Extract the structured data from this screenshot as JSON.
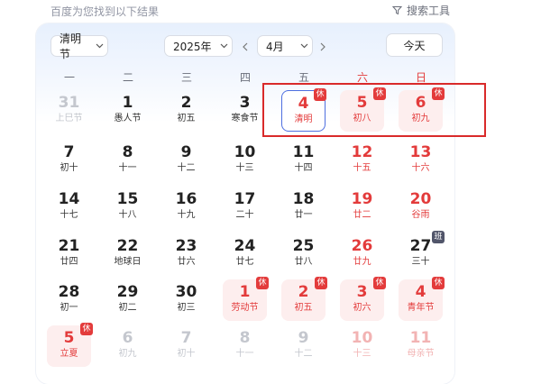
{
  "top": {
    "result_note": "百度为您找到以下结果",
    "tools_label": "搜索工具"
  },
  "controls": {
    "holiday": "清明节",
    "year": "2025年",
    "month": "4月",
    "today": "今天"
  },
  "weekdays": [
    "一",
    "二",
    "三",
    "四",
    "五",
    "六",
    "日"
  ],
  "weeks": [
    [
      {
        "num": "31",
        "sub": "上巳节",
        "faded": true
      },
      {
        "num": "1",
        "sub": "愚人节"
      },
      {
        "num": "2",
        "sub": "初五"
      },
      {
        "num": "3",
        "sub": "寒食节"
      },
      {
        "num": "4",
        "sub": "清明",
        "red": true,
        "selected": true,
        "badge": "休"
      },
      {
        "num": "5",
        "sub": "初八",
        "red": true,
        "holiday": true,
        "badge": "休"
      },
      {
        "num": "6",
        "sub": "初九",
        "red": true,
        "holiday": true,
        "badge": "休"
      }
    ],
    [
      {
        "num": "7",
        "sub": "初十"
      },
      {
        "num": "8",
        "sub": "十一"
      },
      {
        "num": "9",
        "sub": "十二"
      },
      {
        "num": "10",
        "sub": "十三"
      },
      {
        "num": "11",
        "sub": "十四"
      },
      {
        "num": "12",
        "sub": "十五",
        "red": true
      },
      {
        "num": "13",
        "sub": "十六",
        "red": true
      }
    ],
    [
      {
        "num": "14",
        "sub": "十七"
      },
      {
        "num": "15",
        "sub": "十八"
      },
      {
        "num": "16",
        "sub": "十九"
      },
      {
        "num": "17",
        "sub": "二十"
      },
      {
        "num": "18",
        "sub": "廿一"
      },
      {
        "num": "19",
        "sub": "廿二",
        "red": true
      },
      {
        "num": "20",
        "sub": "谷雨",
        "red": true
      }
    ],
    [
      {
        "num": "21",
        "sub": "廿四"
      },
      {
        "num": "22",
        "sub": "地球日"
      },
      {
        "num": "23",
        "sub": "廿六"
      },
      {
        "num": "24",
        "sub": "廿七"
      },
      {
        "num": "25",
        "sub": "廿八"
      },
      {
        "num": "26",
        "sub": "廿九",
        "red": true
      },
      {
        "num": "27",
        "sub": "三十",
        "badge": "班",
        "badge_type": "work"
      }
    ],
    [
      {
        "num": "28",
        "sub": "初一"
      },
      {
        "num": "29",
        "sub": "初二"
      },
      {
        "num": "30",
        "sub": "初三"
      },
      {
        "num": "1",
        "sub": "劳动节",
        "red": true,
        "holiday": true,
        "badge": "休"
      },
      {
        "num": "2",
        "sub": "初五",
        "red": true,
        "holiday": true,
        "badge": "休"
      },
      {
        "num": "3",
        "sub": "初六",
        "red": true,
        "holiday": true,
        "badge": "休"
      },
      {
        "num": "4",
        "sub": "青年节",
        "red": true,
        "holiday": true,
        "badge": "休"
      }
    ],
    [
      {
        "num": "5",
        "sub": "立夏",
        "red": true,
        "holiday": true,
        "badge": "休"
      },
      {
        "num": "6",
        "sub": "初九",
        "faded": true
      },
      {
        "num": "7",
        "sub": "初十",
        "faded": true
      },
      {
        "num": "8",
        "sub": "十一",
        "faded": true
      },
      {
        "num": "9",
        "sub": "十二",
        "faded": true
      },
      {
        "num": "10",
        "sub": "十三",
        "faded": true,
        "red": true
      },
      {
        "num": "11",
        "sub": "母亲节",
        "faded": true,
        "red": true
      }
    ]
  ],
  "colors": {
    "rest_badge": "#e33b3b",
    "work_badge": "#51556a",
    "highlight_box": "#d92a2a",
    "selected_border": "#4e6fe0"
  }
}
